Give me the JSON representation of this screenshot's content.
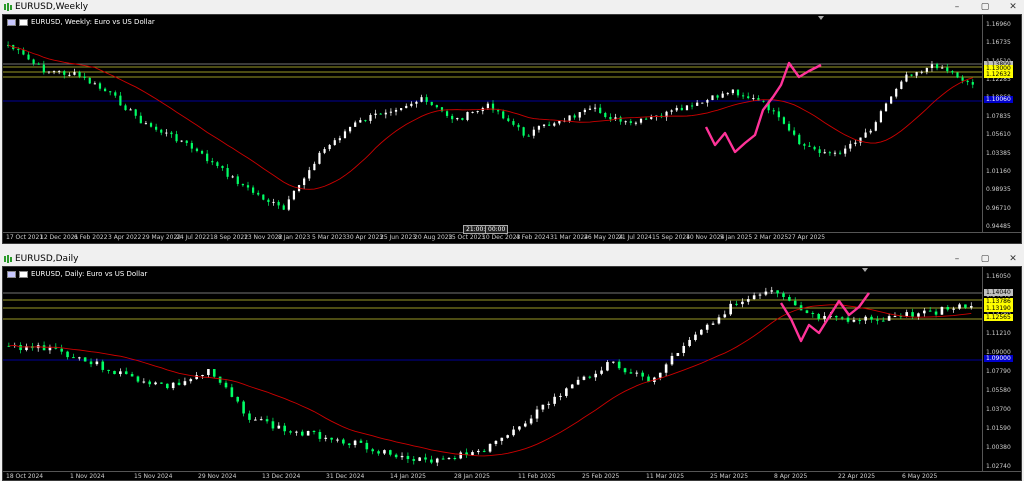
{
  "windows": [
    {
      "title": "EURUSD,Weekly",
      "chart_label": "EURUSD, Weekly:  Euro vs US Dollar",
      "price_ticks": [
        "1.16960",
        "1.16735",
        "1.14510",
        "1.12285",
        "1.10060",
        "1.07835",
        "1.05610",
        "1.03385",
        "1.01160",
        "0.98935",
        "0.96710",
        "0.94485"
      ],
      "price_tags": [
        {
          "text": "1.13809",
          "bg": "#c0c0c0",
          "fg": "#000"
        },
        {
          "text": "1.13000",
          "bg": "#ffff00",
          "fg": "#000"
        },
        {
          "text": "1.12632",
          "bg": "#ffff00",
          "fg": "#000"
        },
        {
          "text": "1.10060",
          "bg": "#0000cc",
          "fg": "#fff"
        }
      ],
      "time_ticks": [
        "17 Oct 2021",
        "12 Dec 2021",
        "6 Feb 2022",
        "3 Apr 2022",
        "29 May 2022",
        "24 Jul 2022",
        "18 Sep 2022",
        "13 Nov 2022",
        "8 Jan 2023",
        "5 Mar 2023",
        "30 Apr 2023",
        "25 Jun 2023",
        "20 Aug 2023",
        "15 Oct 2023",
        "10 Dec 2023",
        "4 Feb 2024",
        "31 Mar 2024",
        "26 May 2024",
        "21 Jul 2024",
        "15 Sep 2024",
        "10 Nov 2024",
        "5 Jan 2025",
        "2 Mar 2025",
        "27 Apr 2025"
      ],
      "crosshair": [
        "21:00:00",
        "00:00"
      ]
    },
    {
      "title": "EURUSD,Daily",
      "chart_label": "EURUSD, Daily:  Euro vs US Dollar",
      "price_ticks": [
        "1.16050",
        "1.14040",
        "1.13780",
        "1.11210",
        "1.09000",
        "1.07790",
        "1.05580",
        "1.03700",
        "1.01590",
        "1.00380",
        "1.02740"
      ],
      "price_tags": [
        {
          "text": "1.14040",
          "bg": "#c0c0c0",
          "fg": "#000"
        },
        {
          "text": "1.13786",
          "bg": "#ffff00",
          "fg": "#000"
        },
        {
          "text": "1.13190",
          "bg": "#ffff00",
          "fg": "#000"
        },
        {
          "text": "1.12565",
          "bg": "#ffff00",
          "fg": "#000"
        },
        {
          "text": "1.09000",
          "bg": "#0000cc",
          "fg": "#fff"
        }
      ],
      "time_ticks": [
        "18 Oct 2024",
        "1 Nov 2024",
        "15 Nov 2024",
        "29 Nov 2024",
        "13 Dec 2024",
        "31 Dec 2024",
        "14 Jan 2025",
        "28 Jan 2025",
        "11 Feb 2025",
        "25 Feb 2025",
        "11 Mar 2025",
        "25 Mar 2025",
        "8 Apr 2025",
        "22 Apr 2025",
        "6 May 2025"
      ]
    }
  ],
  "colors": {
    "bull": "#ffffff",
    "bear": "#00ff66",
    "ma": "#cc0000",
    "pattern": "#ff3399",
    "hline_yellow": "#cccc33",
    "hline_blue": "#0000cc",
    "hline_gray": "#9a9a9a"
  }
}
